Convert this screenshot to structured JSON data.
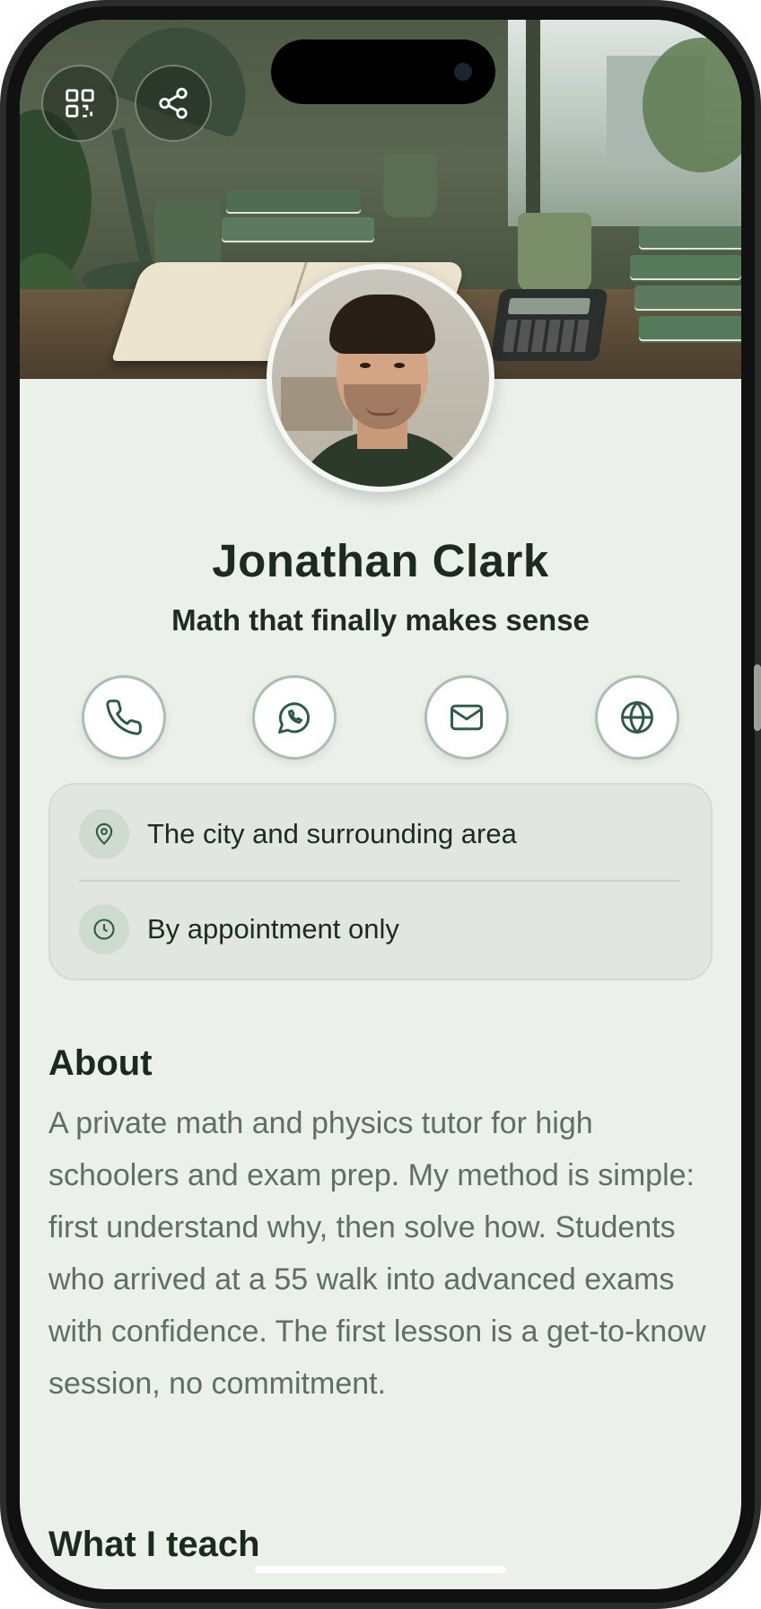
{
  "profile": {
    "name": "Jonathan Clark",
    "tagline": "Math that finally makes sense"
  },
  "hero_buttons": {
    "qr_icon": "qr-code-icon",
    "share_icon": "share-icon"
  },
  "actions": [
    {
      "icon": "phone-icon"
    },
    {
      "icon": "whatsapp-icon"
    },
    {
      "icon": "mail-icon"
    },
    {
      "icon": "globe-icon"
    }
  ],
  "info": {
    "location": "The city and surrounding area",
    "hours": "By appointment only"
  },
  "about": {
    "title": "About",
    "text": "A private math and physics tutor for high schoolers and exam prep. My method is simple: first understand why, then solve how. Students who arrived at a 55 walk into advanced exams with confidence. The first lesson is a get-to-know session, no commitment."
  },
  "teach": {
    "title": "What I teach"
  },
  "colors": {
    "accent": "#2e5a45",
    "background": "#ebf0ea",
    "card": "#e1e7e0",
    "ring": "#a9bfb2"
  }
}
